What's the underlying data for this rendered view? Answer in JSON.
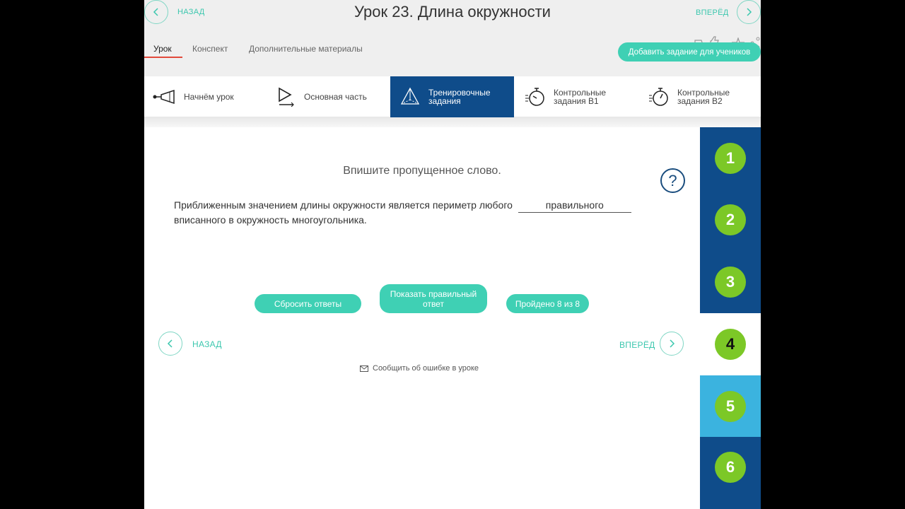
{
  "header": {
    "back_label": "НАЗАД",
    "forward_label": "ВПЕРЁД",
    "title": "Урок 23. Длина окружности",
    "tabs": [
      {
        "label": "Урок"
      },
      {
        "label": "Конспект"
      },
      {
        "label": "Дополнительные материалы"
      }
    ],
    "add_task_label": "Добавить задание для учеников"
  },
  "steps": [
    {
      "label_line1": "Начнём урок",
      "label_line2": "",
      "icon": "megaphone-icon"
    },
    {
      "label_line1": "Основная часть",
      "label_line2": "",
      "icon": "play-icon"
    },
    {
      "label_line1": "Тренировочные",
      "label_line2": "задания",
      "icon": "pyramid-icon"
    },
    {
      "label_line1": "Контрольные",
      "label_line2": "задания В1",
      "icon": "stopwatch-icon"
    },
    {
      "label_line1": "Контрольные",
      "label_line2": "задания В2",
      "icon": "stopwatch-icon"
    }
  ],
  "exercise": {
    "instruction": "Впишите пропущенное слово.",
    "help_symbol": "?",
    "sentence_before": "Приближенным значением длины окружности является периметр любого",
    "answer": "правильного",
    "sentence_after": "вписанного в окружность многоугольника."
  },
  "buttons": {
    "reset": "Сбросить ответы",
    "show_answer_line1": "Показать правильный",
    "show_answer_line2": "ответ",
    "progress": "Пройдено 8 из 8"
  },
  "bottom_nav": {
    "back_label": "НАЗАД",
    "forward_label": "ВПЕРЁД"
  },
  "report_error": "Сообщить об ошибке в уроке",
  "tasks": [
    {
      "number": "1",
      "bg": "#0f4c8a"
    },
    {
      "number": "2",
      "bg": "#0f4c8a"
    },
    {
      "number": "3",
      "bg": "#0f4c8a"
    },
    {
      "number": "4",
      "bg": "#ffffff"
    },
    {
      "number": "5",
      "bg": "#3bb3df"
    },
    {
      "number": "6",
      "bg": "#0f4c8a"
    }
  ],
  "colors": {
    "accent": "#3fd0b4",
    "active_step": "#0f4c8a",
    "task_circle": "#7cc827",
    "tab_underline": "#e24a3b"
  }
}
